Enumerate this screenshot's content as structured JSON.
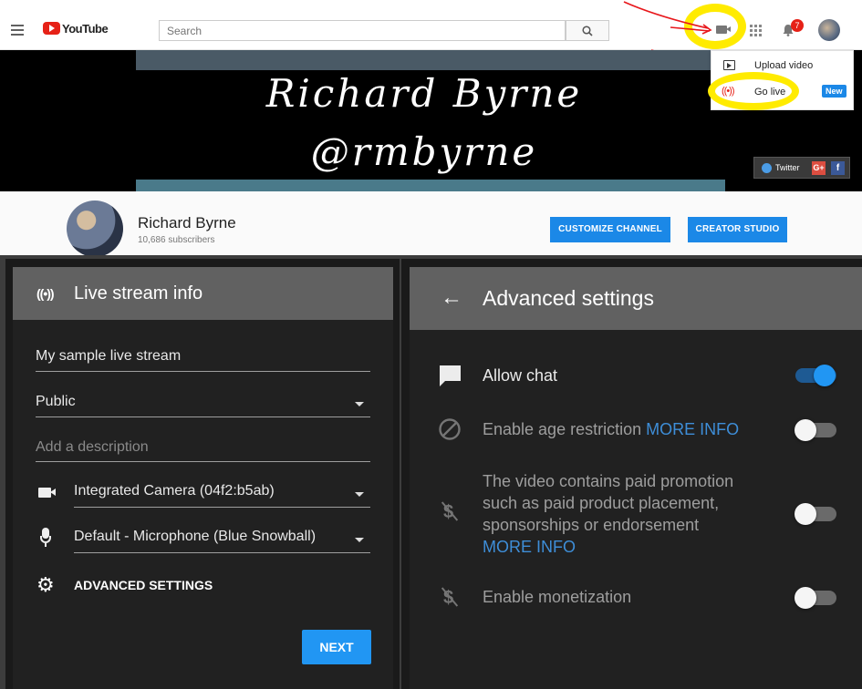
{
  "app": {
    "logo_text": "YouTube"
  },
  "header": {
    "search_placeholder": "Search",
    "notification_count": "7"
  },
  "create_menu": {
    "items": [
      {
        "label": "Upload video"
      },
      {
        "label": "Go live",
        "badge": "New"
      }
    ]
  },
  "banner": {
    "line1": "Richard Byrne",
    "line2": "@rmbyrne",
    "social": {
      "twitter": "Twitter",
      "gplus": "G+",
      "facebook": "f"
    }
  },
  "channel": {
    "name": "Richard Byrne",
    "subscribers": "10,686 subscribers",
    "customize_label": "CUSTOMIZE CHANNEL",
    "studio_label": "CREATOR STUDIO"
  },
  "live_stream_panel": {
    "title": "Live stream info",
    "title_value": "My sample live stream",
    "privacy": "Public",
    "description_placeholder": "Add a description",
    "camera": "Integrated Camera (04f2:b5ab)",
    "microphone": "Default - Microphone (Blue Snowball)",
    "advanced_label": "ADVANCED SETTINGS",
    "next_label": "NEXT"
  },
  "advanced_panel": {
    "title": "Advanced settings",
    "more_info": "MORE INFO",
    "settings": [
      {
        "label": "Allow chat",
        "enabled": true
      },
      {
        "label": "Enable age restriction",
        "enabled": false
      },
      {
        "label_lines": [
          "The video contains paid promotion",
          "such as paid product placement,",
          "sponsorships or endorsement"
        ],
        "enabled": false
      },
      {
        "label": "Enable monetization",
        "enabled": false
      }
    ]
  },
  "colors": {
    "accent_blue": "#1b88e7",
    "toggle_on": "#2196f3",
    "highlight": "#ffeb00",
    "annotation_red": "#e8171b"
  }
}
